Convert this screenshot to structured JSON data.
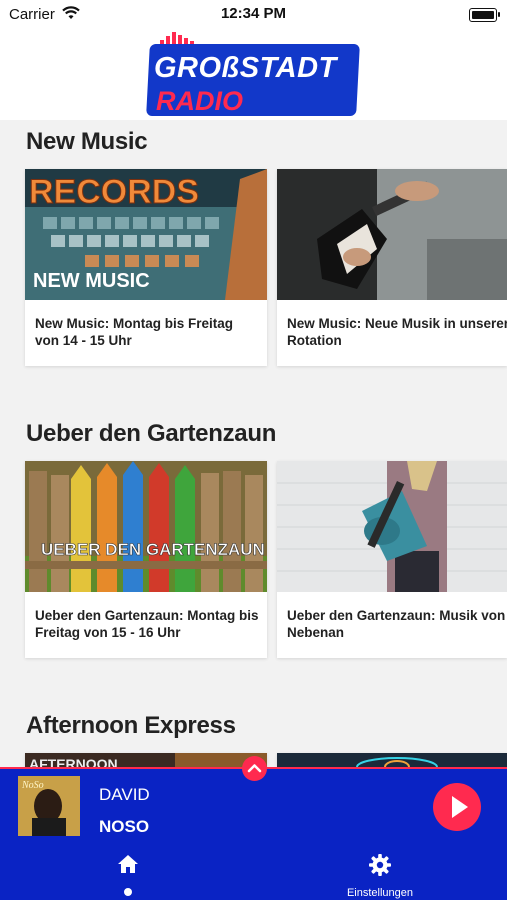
{
  "status": {
    "carrier": "Carrier",
    "time": "12:34 PM"
  },
  "logo": {
    "line1": "GROßSTADT",
    "line2": "RADIO"
  },
  "sections": [
    {
      "title": "New Music",
      "cards": [
        {
          "image_text": "NEW MUSIC",
          "sign_text": "RECORDS",
          "caption": "New Music: Montag bis Freitag von 14 - 15 Uhr"
        },
        {
          "caption": "New Music: Neue Musik in unserer Rotation"
        }
      ]
    },
    {
      "title": "Ueber den Gartenzaun",
      "cards": [
        {
          "image_text": "UEBER DEN GARTENZAUN",
          "caption": "Ueber den Gartenzaun: Montag bis Freitag von 15 - 16 Uhr"
        },
        {
          "caption": "Ueber den Gartenzaun: Musik von Nebenan"
        }
      ]
    },
    {
      "title": "Afternoon Express",
      "cards": [
        {
          "image_text": "AFTERNOON"
        },
        {
          "image_text": ""
        }
      ]
    }
  ],
  "player": {
    "artist": "DAVID",
    "track": "NOSO",
    "cover_text": "NoSo"
  },
  "tabs": {
    "home_icon": "home-icon",
    "settings_icon": "gear-icon",
    "settings_label": "Einstellungen"
  },
  "colors": {
    "brand_blue": "#0a23c4",
    "accent_red": "#ff2a4f"
  }
}
